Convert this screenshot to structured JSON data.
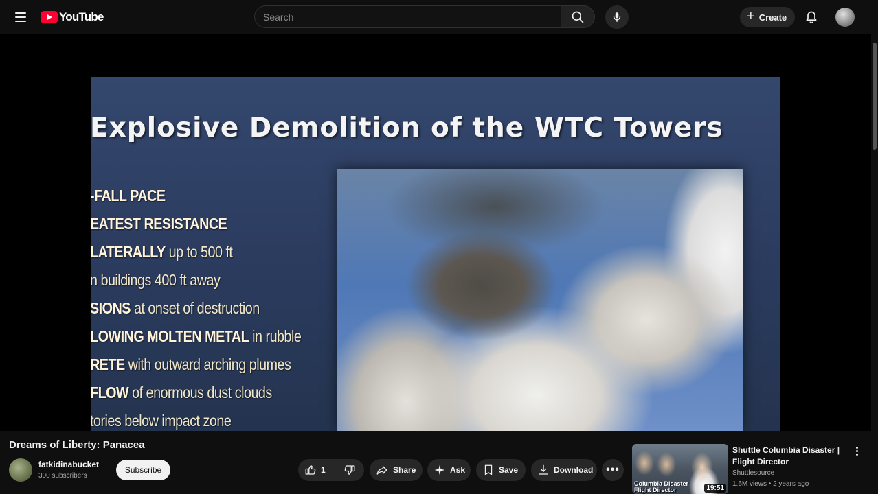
{
  "header": {
    "logo_text": "YouTube",
    "search_placeholder": "Search",
    "create_label": "Create"
  },
  "video": {
    "slide_title": "Explosive Demolition of the WTC Towers",
    "slide_bullets": [
      {
        "bold": "-FALL PACE",
        "rest": ""
      },
      {
        "bold": "EATEST RESISTANCE",
        "rest": ""
      },
      {
        "bold": "LATERALLY",
        "rest": " up to 500 ft"
      },
      {
        "bold": "",
        "rest": "n buildings 400 ft away"
      },
      {
        "bold": "SIONS",
        "rest": " at onset of destruction"
      },
      {
        "bold": "LOWING MOLTEN METAL",
        "rest": " in rubble"
      },
      {
        "bold": "RETE",
        "rest": " with outward arching plumes"
      },
      {
        "bold": " FLOW",
        "rest": " of enormous dust clouds"
      },
      {
        "bold": "",
        "rest": "tories below impact zone"
      }
    ],
    "title": "Dreams of Liberty: Panacea"
  },
  "channel": {
    "name": "fatkidinabucket",
    "subscribers": "300 subscribers",
    "subscribe_label": "Subscribe"
  },
  "actions": {
    "like_count": "1",
    "share_label": "Share",
    "ask_label": "Ask",
    "save_label": "Save",
    "download_label": "Download"
  },
  "recommended": {
    "title": "Shuttle Columbia Disaster | Flight Director Communication...",
    "channel": "Shuttlesource",
    "meta": "1.6M views • 2 years ago",
    "duration": "19:51",
    "thumb_caption_line1": "Columbia Disaster",
    "thumb_caption_line2": "Flight Director"
  },
  "colors": {
    "background": "#0f0f0f",
    "brand_red": "#ff0033",
    "pill_bg": "#272727"
  }
}
